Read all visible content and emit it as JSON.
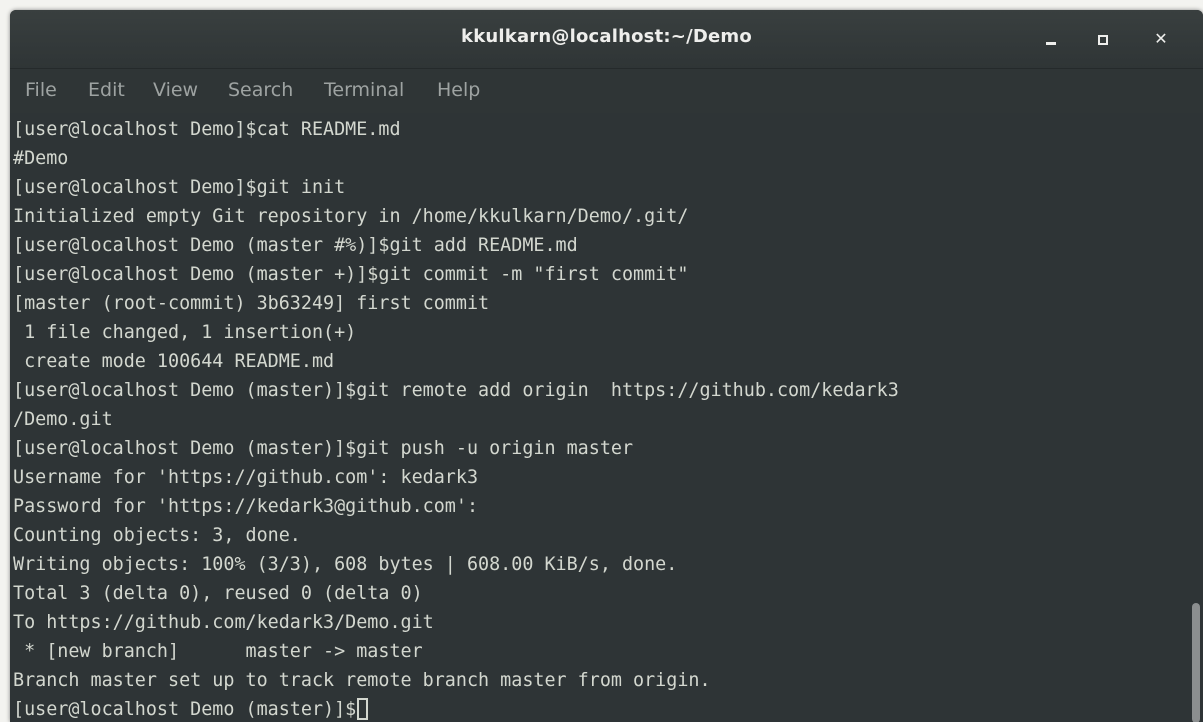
{
  "window": {
    "title": "kkulkarn@localhost:~/Demo",
    "controls": {
      "minimize": "minimize",
      "maximize": "maximize",
      "close": "✕"
    }
  },
  "menu": [
    "File",
    "Edit",
    "View",
    "Search",
    "Terminal",
    "Help"
  ],
  "terminal": {
    "lines": [
      "[user@localhost Demo]$cat README.md",
      "#Demo",
      "[user@localhost Demo]$git init",
      "Initialized empty Git repository in /home/kkulkarn/Demo/.git/",
      "[user@localhost Demo (master #%)]$git add README.md",
      "[user@localhost Demo (master +)]$git commit -m \"first commit\"",
      "[master (root-commit) 3b63249] first commit",
      " 1 file changed, 1 insertion(+)",
      " create mode 100644 README.md",
      "[user@localhost Demo (master)]$git remote add origin  https://github.com/kedark3",
      "/Demo.git",
      "[user@localhost Demo (master)]$git push -u origin master",
      "Username for 'https://github.com': kedark3",
      "Password for 'https://kedark3@github.com':",
      "Counting objects: 3, done.",
      "Writing objects: 100% (3/3), 608 bytes | 608.00 KiB/s, done.",
      "Total 3 (delta 0), reused 0 (delta 0)",
      "To https://github.com/kedark3/Demo.git",
      " * [new branch]      master -> master",
      "Branch master set up to track remote branch master from origin.",
      "[user@localhost Demo (master)]$"
    ]
  },
  "colors": {
    "background": "#2e3436",
    "foreground": "#d3d7cf",
    "menu_text": "#9ea3a2",
    "title_text": "#eeeeec"
  }
}
